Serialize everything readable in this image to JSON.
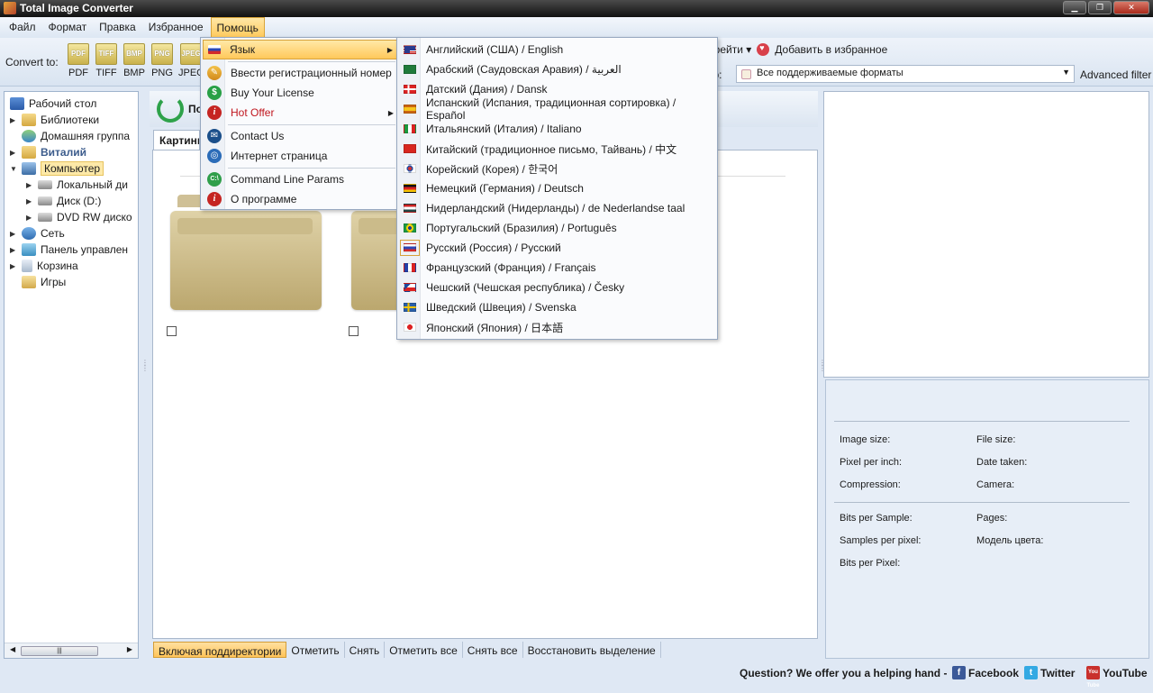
{
  "window": {
    "title": "Total Image Converter"
  },
  "menubar": [
    "Файл",
    "Формат",
    "Правка",
    "Избранное",
    "Помощь"
  ],
  "toolbar": {
    "convert_label": "Convert to:",
    "formats": [
      "PDF",
      "TIFF",
      "BMP",
      "PNG",
      "JPEG"
    ],
    "to_favorites_label": "Добавить в избранное",
    "refresh_menu_label": "ерейти",
    "filter_label": "тр:",
    "filter_value": "Все поддерживаемые форматы",
    "advanced_filter_label": "Advanced filter"
  },
  "tree": {
    "items": [
      {
        "label": "Рабочий стол",
        "icon": "desktop-icon"
      },
      {
        "label": "Библиотеки",
        "icon": "folder-icon"
      },
      {
        "label": "Домашняя группа",
        "icon": "homegroup-icon"
      },
      {
        "label": "Виталий",
        "icon": "user-folder-icon"
      },
      {
        "label": "Компьютер",
        "icon": "computer-icon"
      },
      {
        "label": "Локальный ди",
        "icon": "local-disk-icon"
      },
      {
        "label": "Диск (D:)",
        "icon": "disk-icon"
      },
      {
        "label": "DVD RW диско",
        "icon": "dvd-drive-icon"
      },
      {
        "label": "Сеть",
        "icon": "network-icon"
      },
      {
        "label": "Панель управлен",
        "icon": "control-panel-icon"
      },
      {
        "label": "Корзина",
        "icon": "recycle-bin-icon"
      },
      {
        "label": "Игры",
        "icon": "games-folder-icon"
      }
    ]
  },
  "center": {
    "title": "По",
    "tab_label": "Картинк",
    "bottom_buttons": [
      "Включая поддиректории",
      "Отметить",
      "Снять",
      "Отметить все",
      "Снять все",
      "Восстановить выделение"
    ]
  },
  "info": {
    "image_size": "Image size:",
    "file_size": "File size:",
    "pixel_per_inch": "Pixel per inch:",
    "date_taken": "Date taken:",
    "compression": "Compression:",
    "camera": "Camera:",
    "bits_per_sample": "Bits per Sample:",
    "pages": "Pages:",
    "samples_per_pixel": "Samples per pixel:",
    "color_model": "Модель цвета:",
    "bits_per_pixel": "Bits per Pixel:"
  },
  "help_menu": {
    "language": "Язык",
    "register": "Ввести регистрационный номер",
    "buy": "Buy Your License",
    "hot_offer": "Hot Offer",
    "contact": "Contact Us",
    "web_page": "Интернет страница",
    "cmd_params": "Command Line Params",
    "about": "О программе"
  },
  "languages": [
    "Английский (США) / English",
    "Арабский (Саудовская Аравия) / العربية",
    "Датский (Дания) / Dansk",
    "Испанский (Испания, традиционная сортировка) / Español",
    "Итальянский (Италия) / Italiano",
    "Китайский (традиционное письмо, Тайвань) / 中文",
    "Корейский (Корея) / 한국어",
    "Немецкий (Германия) / Deutsch",
    "Нидерландский (Нидерланды) / de Nederlandse taal",
    "Португальский (Бразилия) / Português",
    "Русский (Россия) / Русский",
    "Французский (Франция) / Français",
    "Чешский (Чешская республика) / Česky",
    "Шведский (Швеция) / Svenska",
    "Японский (Япония) / 日本語"
  ],
  "status": {
    "question": "Question? We offer you a helping hand -",
    "facebook": "Facebook",
    "twitter": "Twitter",
    "youtube": "YouTube",
    "youtube_icon_text": "You Tube"
  }
}
